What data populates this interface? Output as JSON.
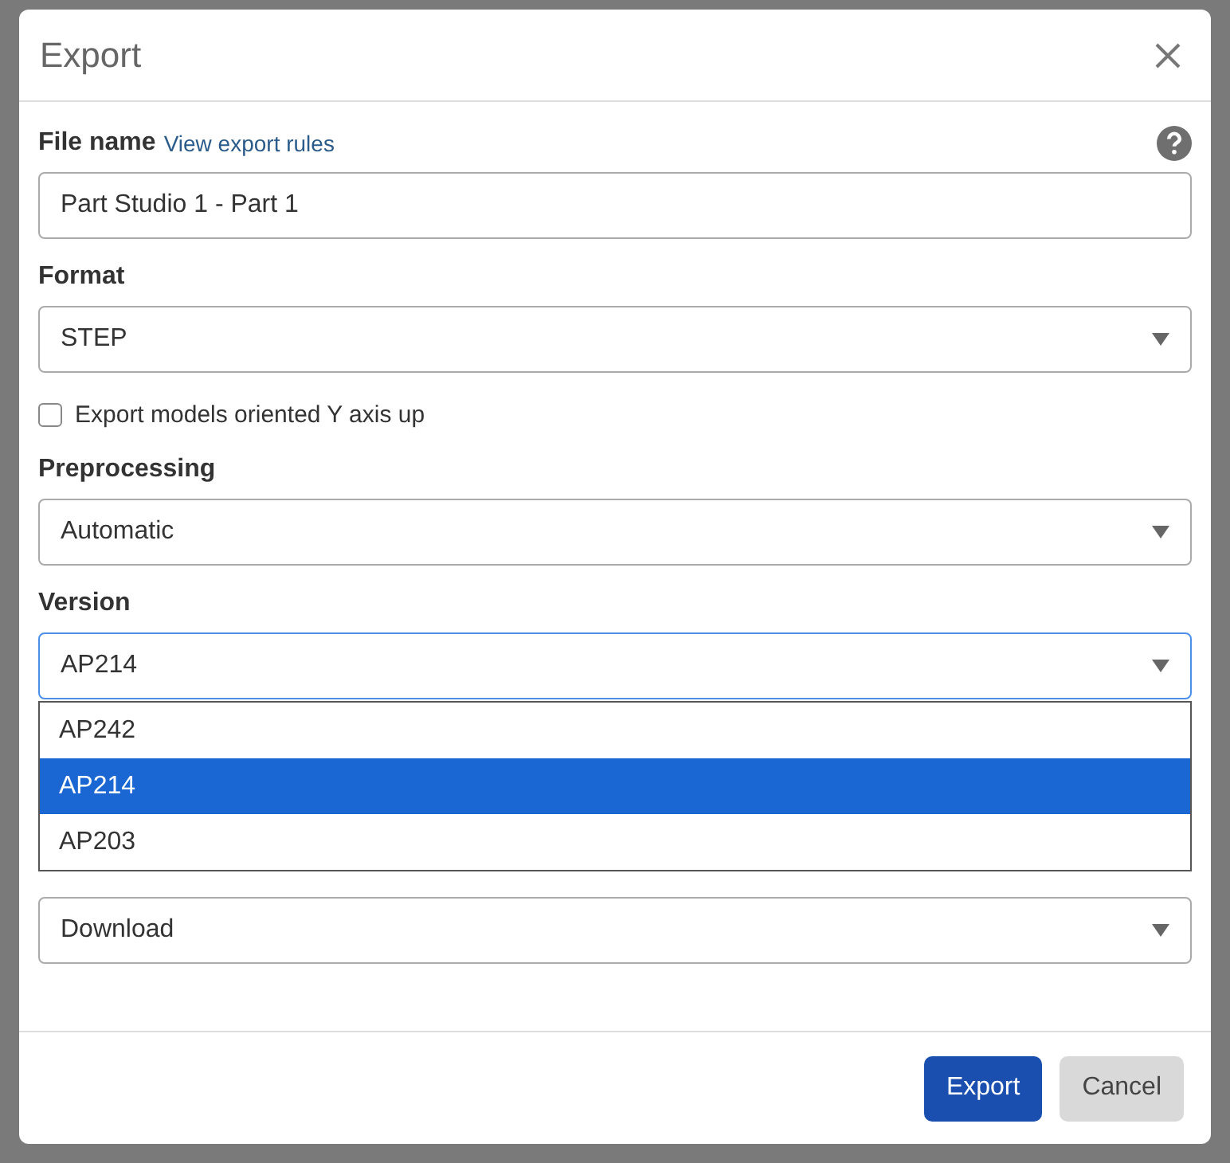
{
  "dialog": {
    "title": "Export"
  },
  "fields": [
    {
      "kind": "text",
      "label": "File name",
      "link": "View export rules",
      "value": "Part Studio 1 - Part 1",
      "help": true
    },
    {
      "kind": "select",
      "label": "Format",
      "value": "STEP",
      "focused": false
    },
    {
      "kind": "checkbox",
      "label": "Export models oriented Y axis up",
      "checked": false
    },
    {
      "kind": "select",
      "label": "Preprocessing",
      "value": "Automatic",
      "focused": false
    },
    {
      "kind": "select",
      "label": "Version",
      "value": "AP214",
      "focused": true,
      "options": [
        {
          "label": "AP242",
          "selected": false
        },
        {
          "label": "AP214",
          "selected": true
        },
        {
          "label": "AP203",
          "selected": false
        }
      ]
    },
    {
      "kind": "select",
      "value": "Download",
      "focused": false
    }
  ],
  "buttons": [
    {
      "label": "Export",
      "primary": true
    },
    {
      "label": "Cancel",
      "primary": false
    }
  ]
}
